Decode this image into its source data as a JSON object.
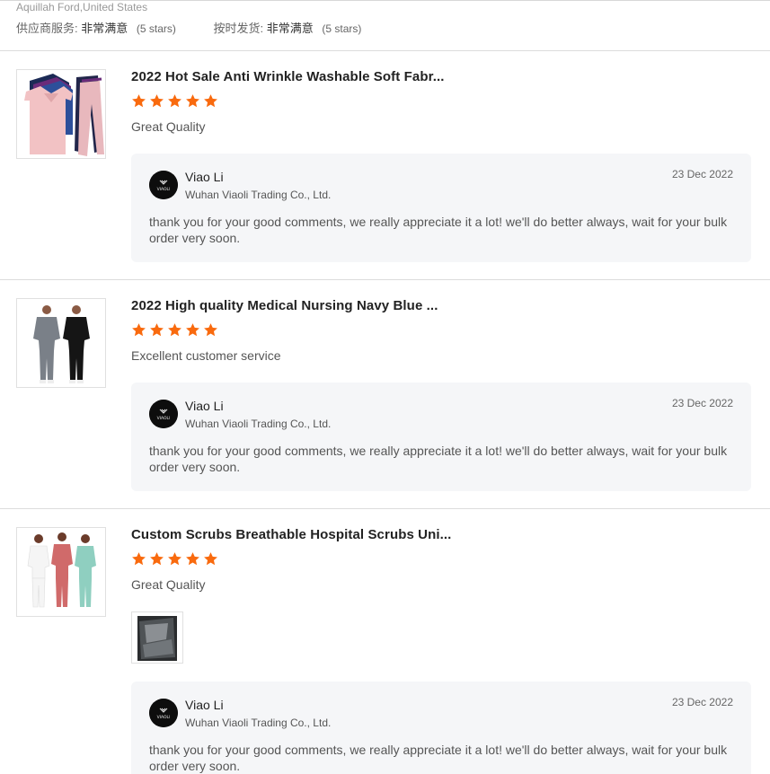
{
  "reviewer": {
    "name_location": "Aquillah Ford,United States"
  },
  "supplier_ratings": [
    {
      "label": "供应商服务:",
      "value": "非常满意",
      "note": "(5 stars)"
    },
    {
      "label": "按时发货:",
      "value": "非常满意",
      "note": "(5 stars)"
    }
  ],
  "colors": {
    "star": "#f96a0e",
    "reply_bg": "#f5f6f8",
    "divider": "#dcdcdc"
  },
  "reviews": [
    {
      "product_title": "2022 Hot Sale Anti Wrinkle Washable Soft Fabr...",
      "rating": 5,
      "comment": "Great Quality",
      "thumbnail_icon": "scrubs-stack-image",
      "reply": {
        "name": "Viao Li",
        "company": "Wuhan Viaoli Trading Co., Ltd.",
        "date": "23 Dec 2022",
        "text": "thank you for your good comments, we really appreciate it a lot! we'll do better always, wait for your bulk order very soon.",
        "avatar_text": "VIAOLI"
      }
    },
    {
      "product_title": "2022 High quality Medical Nursing Navy Blue ...",
      "rating": 5,
      "comment": "Excellent customer service",
      "thumbnail_icon": "two-models-scrubs-image",
      "reply": {
        "name": "Viao Li",
        "company": "Wuhan Viaoli Trading Co., Ltd.",
        "date": "23 Dec 2022",
        "text": "thank you for your good comments, we really appreciate it a lot! we'll do better always, wait for your bulk order very soon.",
        "avatar_text": "VIAOLI"
      }
    },
    {
      "product_title": "Custom Scrubs Breathable Hospital Scrubs Uni...",
      "rating": 5,
      "comment": "Great Quality",
      "thumbnail_icon": "three-models-scrubs-image",
      "has_photo": true,
      "reply": {
        "name": "Viao Li",
        "company": "Wuhan Viaoli Trading Co., Ltd.",
        "date": "23 Dec 2022",
        "text": "thank you for your good comments, we really appreciate it a lot! we'll do better always, wait for your bulk order very soon.",
        "avatar_text": "VIAOLI"
      }
    }
  ]
}
